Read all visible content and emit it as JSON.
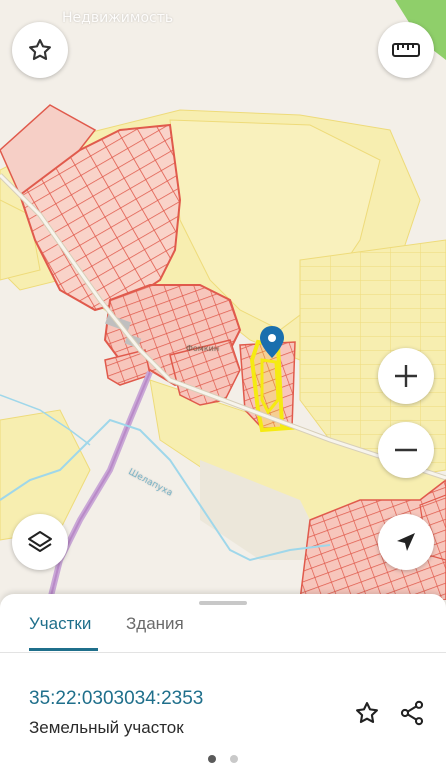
{
  "map": {
    "label_realestate": "Недвижимость",
    "label_village": "Фомкин",
    "label_river": "Шелапуха"
  },
  "controls": {
    "favorite_icon": "star-outline-icon",
    "ruler_icon": "ruler-icon",
    "zoom_in_icon": "plus-icon",
    "zoom_out_icon": "minus-icon",
    "layers_icon": "layers-icon",
    "location_icon": "navigation-arrow-icon"
  },
  "sheet": {
    "tabs": [
      {
        "label": "Участки",
        "active": true
      },
      {
        "label": "Здания",
        "active": false
      }
    ],
    "cadastral_number": "35:22:0303034:2353",
    "parcel_type": "Земельный участок",
    "actions": {
      "favorite_icon": "star-outline-icon",
      "share_icon": "share-icon"
    },
    "pager": {
      "count": 2,
      "active_index": 0
    }
  },
  "colors": {
    "accent": "#1f6f8b",
    "parcel_outline": "#e05a4c",
    "parcel_fill": "#f7c6bc",
    "zone_fill": "#f7eeb0",
    "selected_parcel": "#f5ea12",
    "pin": "#1a6fae"
  }
}
